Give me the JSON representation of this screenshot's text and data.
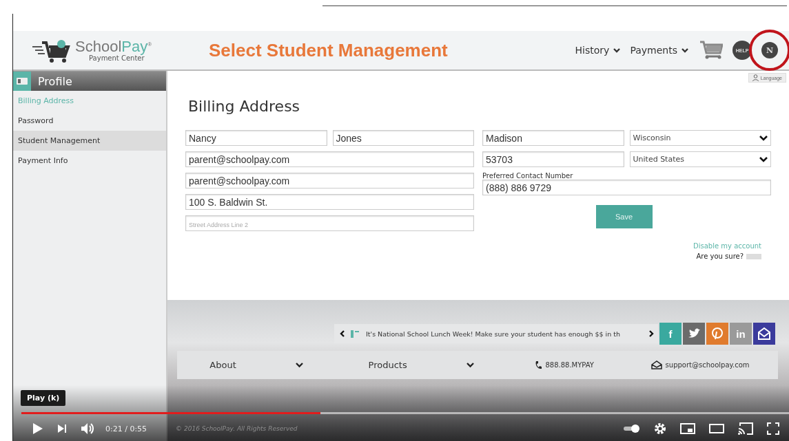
{
  "header": {
    "logo_primary": "School",
    "logo_accent": "Pay",
    "logo_mark": "®",
    "tagline": "Payment Center",
    "title": "Select Student Management",
    "nav": [
      {
        "label": "History"
      },
      {
        "label": "Payments"
      }
    ],
    "help_label": "HELP",
    "avatar": {
      "initial": "N",
      "circled": true
    }
  },
  "sidebar": {
    "title": "Profile",
    "items": [
      {
        "label": "Billing Address",
        "selected": true,
        "hovered": false
      },
      {
        "label": "Password",
        "selected": false,
        "hovered": false
      },
      {
        "label": "Student Management",
        "selected": false,
        "hovered": true
      },
      {
        "label": "Payment Info",
        "selected": false,
        "hovered": false
      }
    ]
  },
  "language": "Language",
  "form": {
    "title": "Billing Address",
    "left_rows": [
      [
        {
          "kind": "text",
          "value": "Nancy"
        },
        {
          "kind": "text",
          "value": "Jones"
        }
      ],
      [
        {
          "kind": "text",
          "value": "parent@schoolpay.com"
        }
      ],
      [
        {
          "kind": "text",
          "value": "parent@schoolpay.com"
        }
      ],
      [
        {
          "kind": "text",
          "value": "100 S. Baldwin St."
        }
      ],
      [
        {
          "kind": "text",
          "placeholder": "Street Address Line 2"
        }
      ]
    ],
    "right_rows": [
      [
        {
          "kind": "text",
          "value": "Madison"
        },
        {
          "kind": "select",
          "value": "Wisconsin"
        }
      ],
      [
        {
          "kind": "text",
          "value": "53703"
        },
        {
          "kind": "select",
          "value": "United States"
        }
      ]
    ],
    "phone_label": "Preferred Contact Number",
    "phone": "(888) 886 9729",
    "save": "Save",
    "disable_link": "Disable my account",
    "confirm": "Are you sure?"
  },
  "footer": {
    "ticker": "It's National School Lunch Week! Make sure your student has enough $$ in th",
    "social": [
      {
        "kind": "text",
        "label": "f",
        "color": "#3aa99f"
      },
      {
        "kind": "bird",
        "color": "#6b6b6b"
      },
      {
        "kind": "pin",
        "color": "#e07b2e"
      },
      {
        "kind": "text",
        "label": "in",
        "color": "#9a9a9a"
      },
      {
        "kind": "mail",
        "color": "#3b3b9c"
      }
    ],
    "menus": [
      {
        "label": "About"
      },
      {
        "label": "Products"
      }
    ],
    "phone": "888.88.MYPAY",
    "email": "support@schoolpay.com",
    "copyright": "© 2016 SchoolPay. All Rights Reserved"
  },
  "player": {
    "tooltip": "Play (k)",
    "time": "0:21 / 0:55",
    "progress": {
      "level": 0.39
    },
    "autoplay": true
  }
}
